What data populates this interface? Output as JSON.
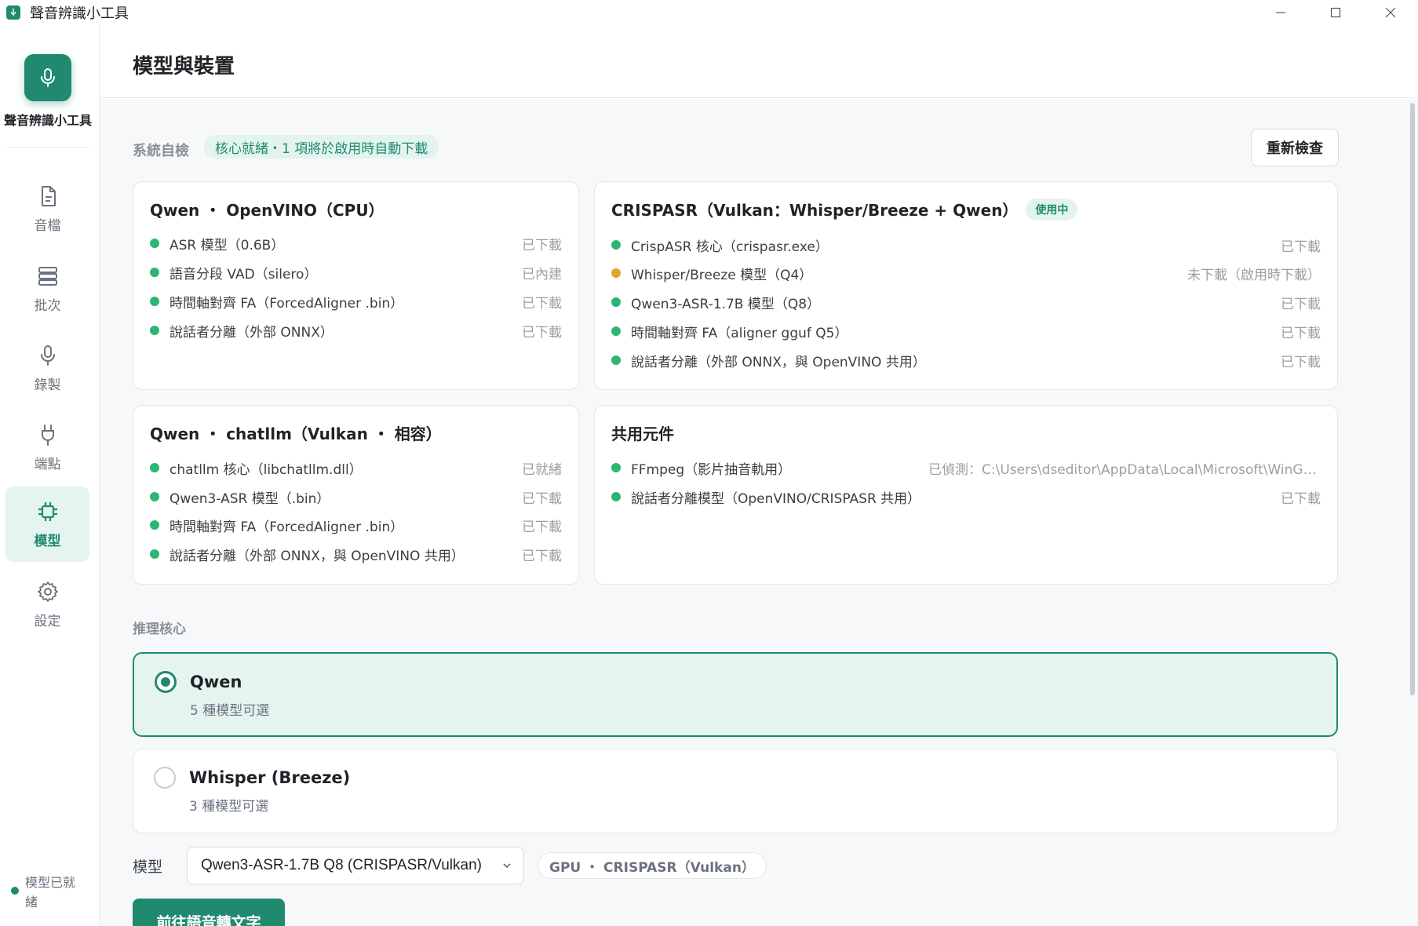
{
  "window": {
    "title": "聲音辨識小工具"
  },
  "sidebar": {
    "app_name": "聲音辨識小工具",
    "items": [
      {
        "label": "音檔",
        "icon": "file-icon"
      },
      {
        "label": "批次",
        "icon": "stack-icon"
      },
      {
        "label": "錄製",
        "icon": "microphone-icon"
      },
      {
        "label": "端點",
        "icon": "plug-icon"
      },
      {
        "label": "模型",
        "icon": "chip-icon",
        "active": true
      },
      {
        "label": "設定",
        "icon": "gear-icon"
      }
    ],
    "status": "模型已就緒"
  },
  "header": {
    "title": "模型與裝置"
  },
  "self_check": {
    "label": "系統自檢",
    "summary": "核心就緒・1 項將於啟用時自動下載",
    "recheck_button": "重新檢查"
  },
  "cards": {
    "qwen_openvino": {
      "title": "Qwen ・ OpenVINO（CPU）",
      "rows": [
        {
          "name": "ASR 模型（0.6B）",
          "status": "已下載",
          "state": "ok"
        },
        {
          "name": "語音分段 VAD（silero）",
          "status": "已內建",
          "state": "ok"
        },
        {
          "name": "時間軸對齊 FA（ForcedAligner .bin）",
          "status": "已下載",
          "state": "ok"
        },
        {
          "name": "說話者分離（外部 ONNX）",
          "status": "已下載",
          "state": "ok"
        }
      ]
    },
    "crispasr": {
      "title": "CRISPASR（Vulkan：Whisper/Breeze + Qwen）",
      "badge": "使用中",
      "rows": [
        {
          "name": "CrispASR 核心（crispasr.exe）",
          "status": "已下載",
          "state": "ok"
        },
        {
          "name": "Whisper/Breeze 模型（Q4）",
          "status": "未下載（啟用時下載）",
          "state": "warn"
        },
        {
          "name": "Qwen3-ASR-1.7B 模型（Q8）",
          "status": "已下載",
          "state": "ok"
        },
        {
          "name": "時間軸對齊 FA（aligner gguf Q5）",
          "status": "已下載",
          "state": "ok"
        },
        {
          "name": "說話者分離（外部 ONNX，與 OpenVINO 共用）",
          "status": "已下載",
          "state": "ok"
        }
      ]
    },
    "qwen_chatllm": {
      "title": "Qwen ・ chatllm（Vulkan ・ 相容）",
      "rows": [
        {
          "name": "chatllm 核心（libchatllm.dll）",
          "status": "已就緒",
          "state": "ok"
        },
        {
          "name": "Qwen3-ASR 模型（.bin）",
          "status": "已下載",
          "state": "ok"
        },
        {
          "name": "時間軸對齊 FA（ForcedAligner .bin）",
          "status": "已下載",
          "state": "ok"
        },
        {
          "name": "說話者分離（外部 ONNX，與 OpenVINO 共用）",
          "status": "已下載",
          "state": "ok"
        }
      ]
    },
    "shared": {
      "title": "共用元件",
      "rows": [
        {
          "name": "FFmpeg（影片抽音軌用）",
          "status": "已偵測：C:\\Users\\dseditor\\AppData\\Local\\Microsoft\\WinGet\\Packages",
          "state": "ok"
        },
        {
          "name": "說話者分離模型（OpenVINO/CRISPASR 共用）",
          "status": "已下載",
          "state": "ok"
        }
      ]
    }
  },
  "inference": {
    "label": "推理核心",
    "options": [
      {
        "title": "Qwen",
        "subtitle": "5 種模型可選",
        "selected": true
      },
      {
        "title": "Whisper (Breeze)",
        "subtitle": "3 種模型可選",
        "selected": false
      }
    ]
  },
  "model": {
    "label": "模型",
    "selected": "Qwen3-ASR-1.7B Q8 (CRISPASR/Vulkan)",
    "device": "GPU ・ CRISPASR（Vulkan）"
  },
  "go_button": "前往語音轉文字",
  "colors": {
    "accent": "#1f8a6f",
    "ok": "#2bb673",
    "warn": "#e2a32f"
  }
}
